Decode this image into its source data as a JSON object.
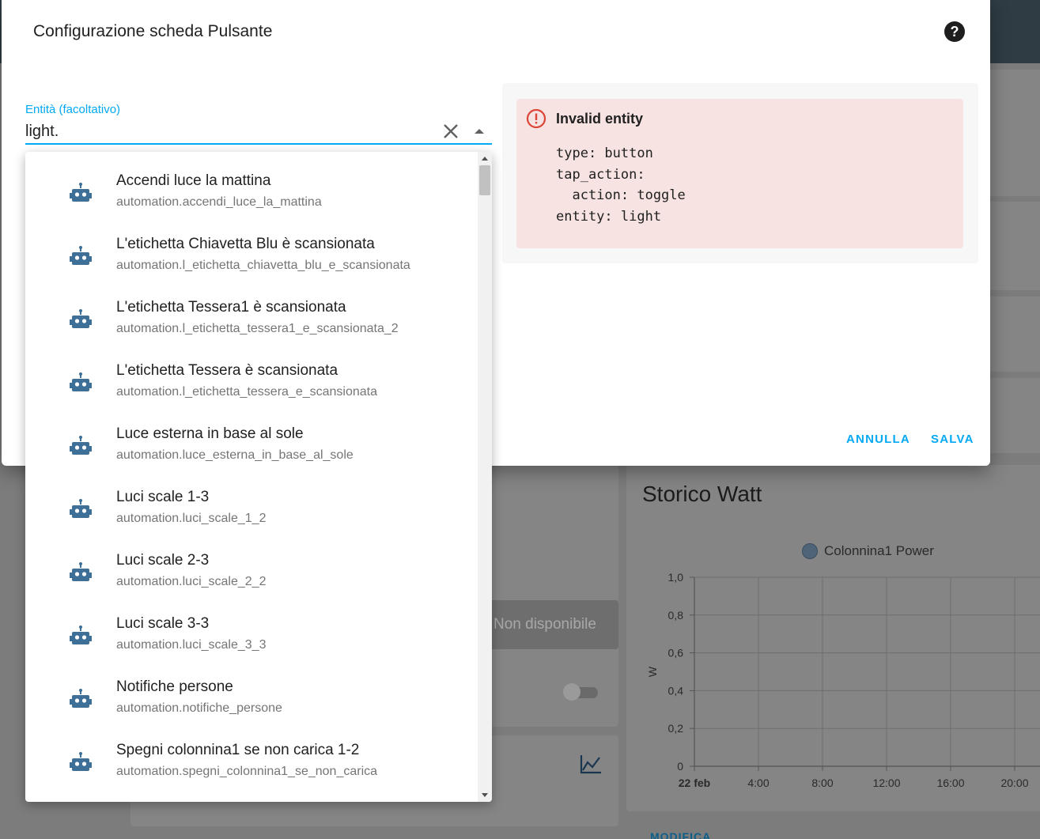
{
  "dialog": {
    "title": "Configurazione scheda Pulsante",
    "help_icon": "help-circle-icon"
  },
  "entity_field": {
    "label": "Entità (facoltativo)",
    "value": "light.",
    "clear_icon": "close-icon",
    "toggle_icon": "caret-up-icon"
  },
  "preview": {
    "alert_title": "Invalid entity",
    "alert_icon": "alert-circle-icon",
    "code": "type: button\ntap_action:\n  action: toggle\nentity: light"
  },
  "actions": {
    "cancel_label": "ANNULLA",
    "save_label": "SALVA"
  },
  "dropdown": {
    "item_icon": "robot-icon",
    "items": [
      {
        "name": "Accendi luce la mattina",
        "entity_id": "automation.accendi_luce_la_mattina"
      },
      {
        "name": "L'etichetta Chiavetta Blu è scansionata",
        "entity_id": "automation.l_etichetta_chiavetta_blu_e_scansionata"
      },
      {
        "name": "L'etichetta Tessera1 è scansionata",
        "entity_id": "automation.l_etichetta_tessera1_e_scansionata_2"
      },
      {
        "name": "L'etichetta Tessera è scansionata",
        "entity_id": "automation.l_etichetta_tessera_e_scansionata"
      },
      {
        "name": "Luce esterna in base al sole",
        "entity_id": "automation.luce_esterna_in_base_al_sole"
      },
      {
        "name": "Luci scale 1-3",
        "entity_id": "automation.luci_scale_1_2"
      },
      {
        "name": "Luci scale 2-3",
        "entity_id": "automation.luci_scale_2_2"
      },
      {
        "name": "Luci scale 3-3",
        "entity_id": "automation.luci_scale_3_3"
      },
      {
        "name": "Notifiche persone",
        "entity_id": "automation.notifiche_persone"
      },
      {
        "name": "Spegni colonnina1 se non carica 1-2",
        "entity_id": "automation.spegni_colonnina1_se_non_carica"
      }
    ]
  },
  "background": {
    "unavailable_label": "Non disponibile",
    "graph_icon": "chart-line-icon",
    "modifica_label": "MODIFICA",
    "colors": {
      "header": "#2f3c44",
      "accent": "#03a9f4",
      "alert_bg": "#f7e3e2",
      "alert_icon": "#db4437"
    }
  },
  "chart_data": {
    "type": "line",
    "title": "Storico Watt",
    "ylabel": "W",
    "xlabel": "",
    "legend": [
      "Colonnina1 Power"
    ],
    "legend_position": "top",
    "ylim": [
      0,
      1.0
    ],
    "y_ticks": [
      "0",
      "0,2",
      "0,4",
      "0,6",
      "0,8",
      "1,0"
    ],
    "x_ticks": [
      "22 feb",
      "4:00",
      "8:00",
      "12:00",
      "16:00",
      "20:00"
    ],
    "series": [
      {
        "name": "Colonnina1 Power",
        "values": []
      }
    ],
    "grid": true
  }
}
